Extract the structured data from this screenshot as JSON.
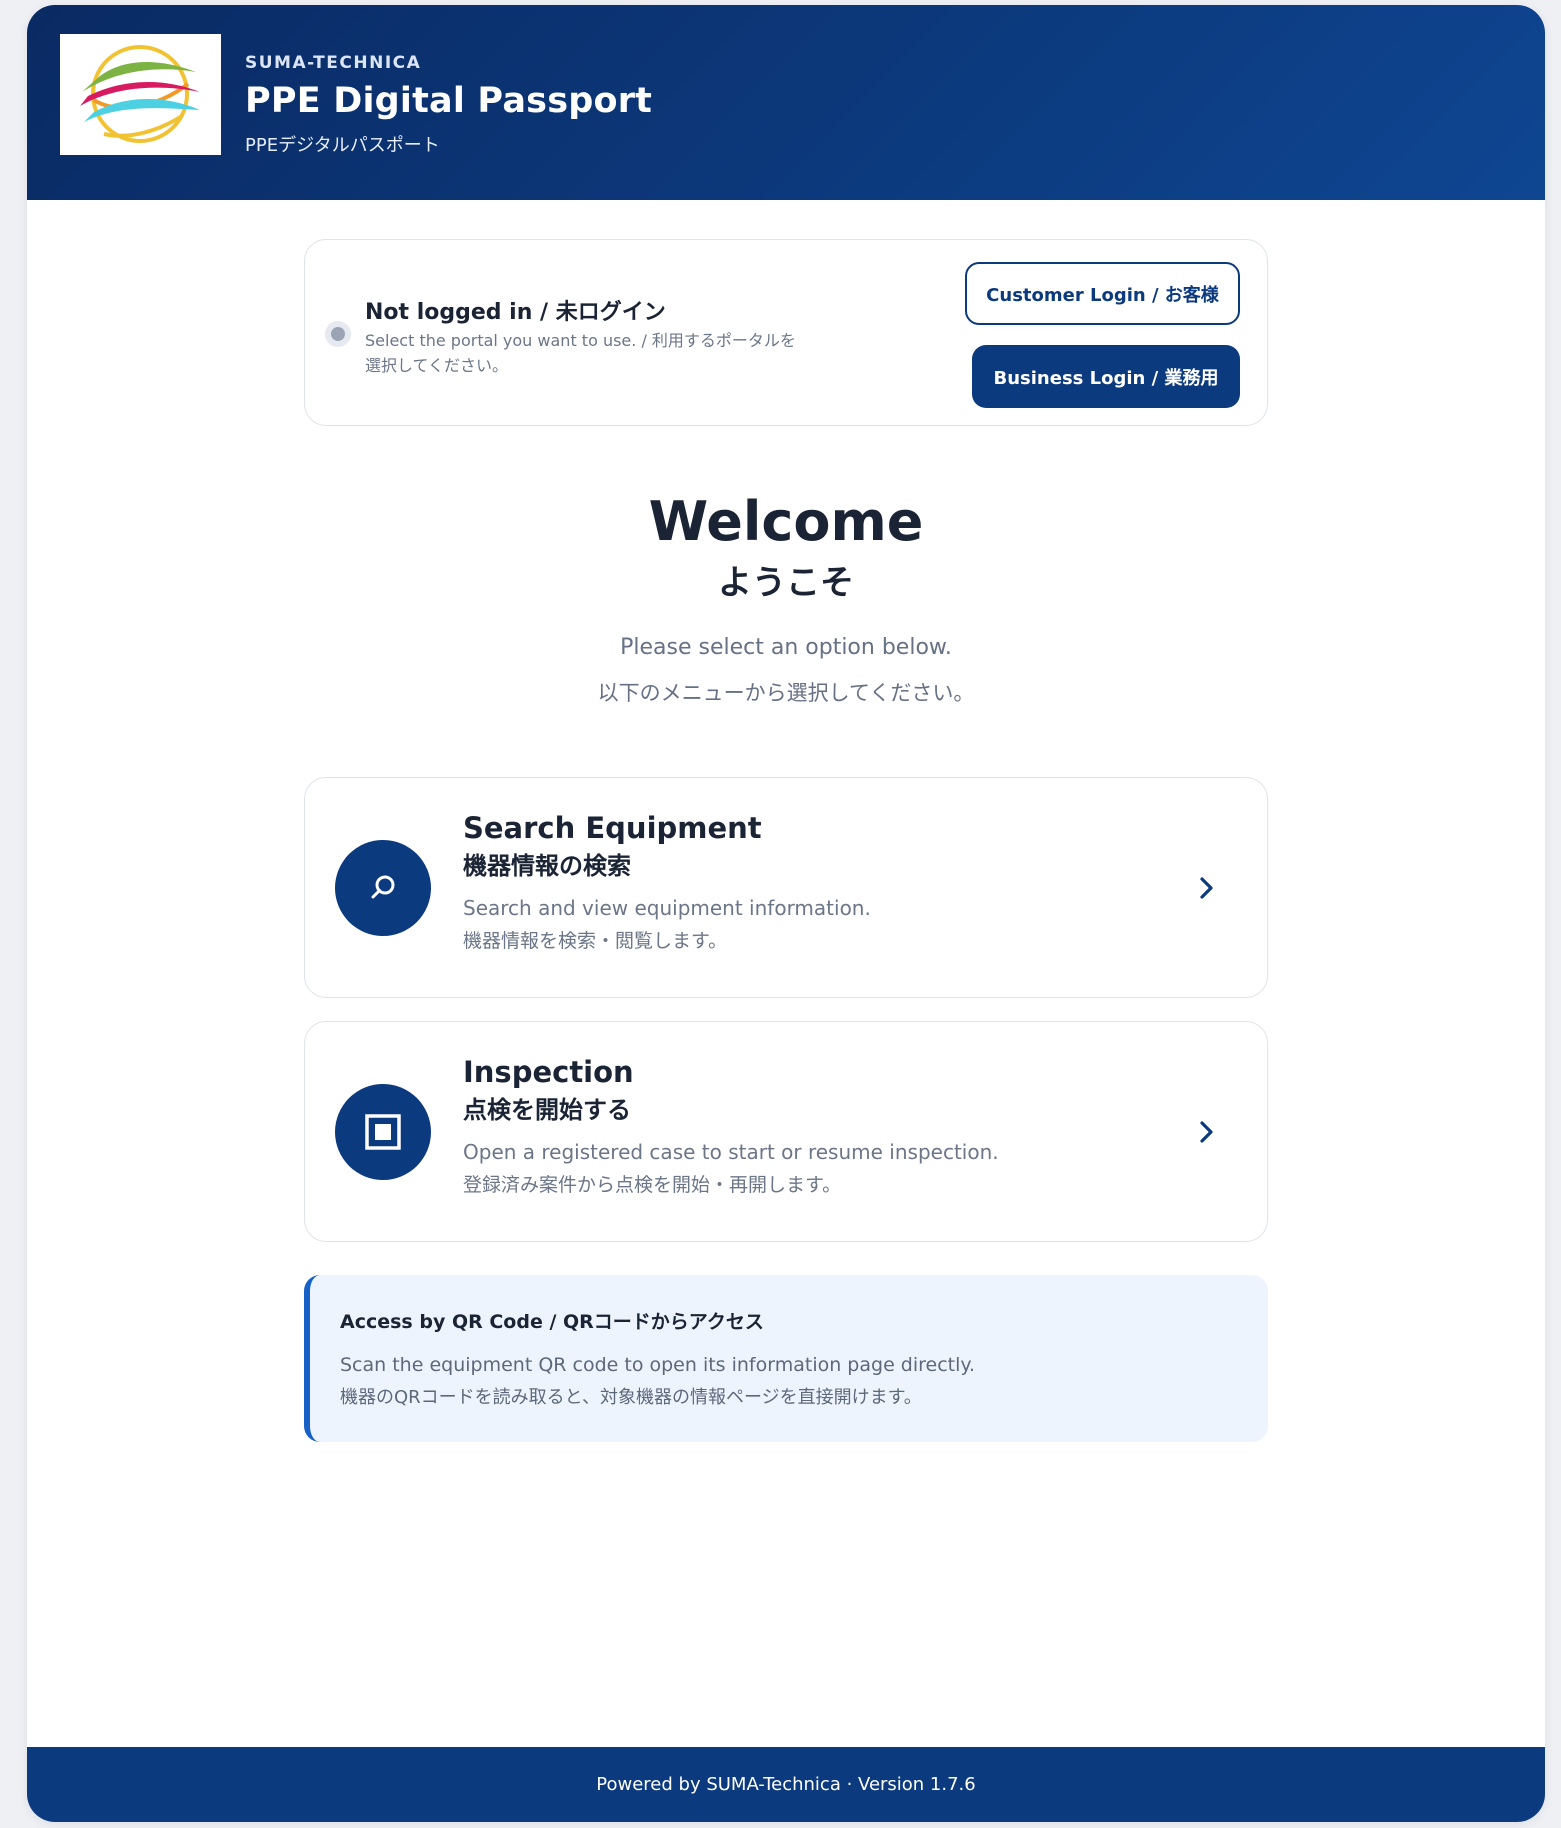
{
  "header": {
    "company": "SUMA-TECHNICA",
    "title": "PPE Digital Passport",
    "subtitle": "PPEデジタルパスポート",
    "logo_icon": "company-logo-waves"
  },
  "status": {
    "title": "Not logged in / 未ログイン",
    "description": "Select the portal you want to use. / 利用するポータルを選択してください。",
    "indicator_color": "#9aa4b5"
  },
  "login": {
    "customer_label": "Customer Login / お客様",
    "business_label": "Business Login / 業務用"
  },
  "welcome": {
    "title": "Welcome",
    "title_ja": "ようこそ",
    "description": "Please select an option below.",
    "description_ja": "以下のメニューから選択してください。"
  },
  "options": [
    {
      "title": "Search Equipment",
      "title_ja": "機器情報の検索",
      "description": "Search and view equipment information.",
      "description_ja": "機器情報を検索・閲覧します。",
      "icon": "search-icon"
    },
    {
      "title": "Inspection",
      "title_ja": "点検を開始する",
      "description": "Open a registered case to start or resume inspection.",
      "description_ja": "登録済み案件から点検を開始・再開します。",
      "icon": "inspection-square-icon"
    }
  ],
  "qr": {
    "title": "Access by QR Code / QRコードからアクセス",
    "description": "Scan the equipment QR code to open its information page directly.",
    "description_ja": "機器のQRコードを読み取ると、対象機器の情報ページを直接開けます。"
  },
  "footer": {
    "text": "Powered by SUMA-Technica · Version 1.7.6"
  },
  "colors": {
    "primary": "#0c3a7e",
    "accent": "#1760c7",
    "info_bg": "#eef4fd"
  }
}
